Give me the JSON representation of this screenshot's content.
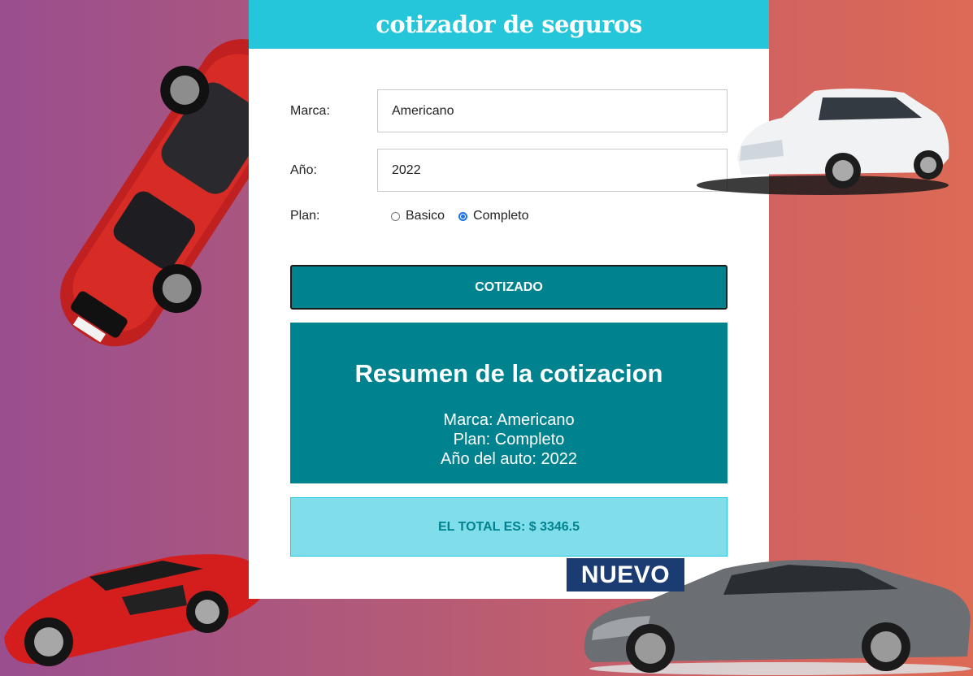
{
  "header": {
    "title": "cotizador de seguros"
  },
  "form": {
    "marca_label": "Marca:",
    "marca_value": "Americano",
    "anio_label": "Año:",
    "anio_value": "2022",
    "plan_label": "Plan:",
    "plan_options": [
      "Basico",
      "Completo"
    ],
    "plan_selected": "Completo"
  },
  "button": {
    "label": "COTIZADO"
  },
  "summary": {
    "title": "Resumen de la cotizacion",
    "marca_line": "Marca: Americano",
    "plan_line": "Plan: Completo",
    "anio_line": "Año del auto: 2022"
  },
  "total": {
    "text": "EL TOTAL ES: $ 3346.5"
  },
  "banner": {
    "text": "NUEVO"
  },
  "colors": {
    "header": "#25c5da",
    "primary": "#00838f",
    "total_bg": "#80deea",
    "banner": "#1b3c73",
    "radio_checked": "#1a73e8"
  },
  "icons": [
    "red-sedan-car-image",
    "white-hatchback-car-image",
    "red-sports-car-image",
    "gray-sedan-car-image"
  ]
}
